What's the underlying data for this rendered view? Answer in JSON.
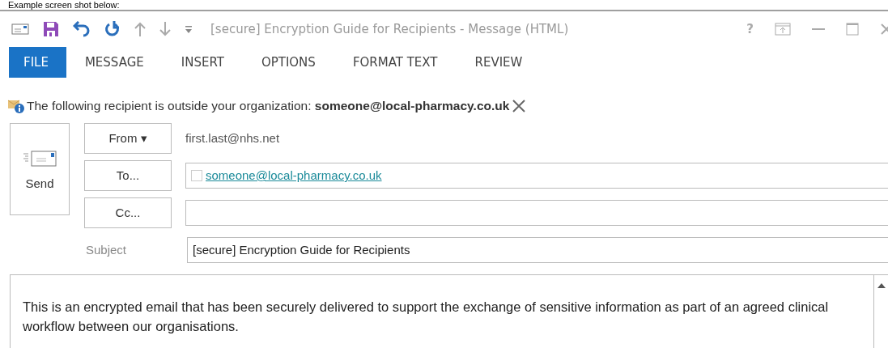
{
  "caption": "Example screen shot below:",
  "window": {
    "title": "[secure] Encryption Guide for Recipients - Message (HTML)",
    "help": "?"
  },
  "tabs": [
    {
      "label": "FILE",
      "selected": true
    },
    {
      "label": "MESSAGE",
      "selected": false
    },
    {
      "label": "INSERT",
      "selected": false
    },
    {
      "label": "OPTIONS",
      "selected": false
    },
    {
      "label": "FORMAT TEXT",
      "selected": false
    },
    {
      "label": "REVIEW",
      "selected": false
    }
  ],
  "infobar": {
    "text": "The following recipient is outside your organization: **someone@local-pharmacy.co.uk**"
  },
  "send_button": "Send",
  "fields": [
    {
      "kind": "value",
      "button": "From ▾",
      "value": "first.last@nhs.net"
    },
    {
      "kind": "recipient",
      "button": "To...",
      "recipient": "someone@local-pharmacy.co.uk",
      "checked": false
    },
    {
      "kind": "recipient",
      "button": "Cc..."
    },
    {
      "kind": "input",
      "label": "Subject",
      "value": "[secure] Encryption Guide for Recipients"
    }
  ],
  "body": {
    "text": "This is an encrypted email that has been securely delivered to support the exchange of sensitive information as part of an agreed clinical workflow between our organisations."
  }
}
